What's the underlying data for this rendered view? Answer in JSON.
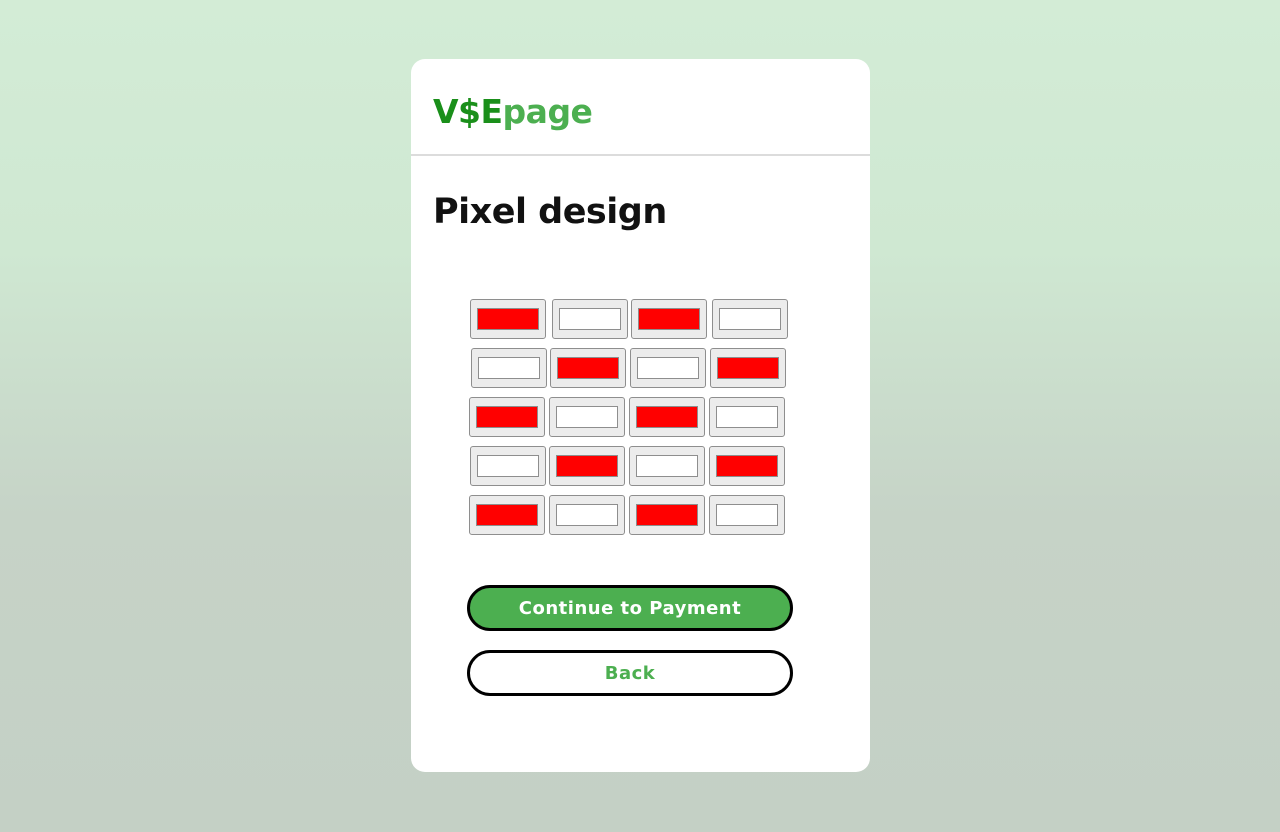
{
  "brand": {
    "part1": "V$E",
    "part2": "page"
  },
  "page_title": "Pixel design",
  "pixel_grid": {
    "on_color": "#ff0000",
    "off_color": "#ffffff",
    "rows": [
      [
        true,
        false,
        true,
        false
      ],
      [
        false,
        true,
        false,
        true
      ],
      [
        true,
        false,
        true,
        false
      ],
      [
        false,
        true,
        false,
        true
      ],
      [
        true,
        false,
        true,
        false
      ]
    ]
  },
  "actions": {
    "continue_label": "Continue to Payment",
    "back_label": "Back"
  },
  "colors": {
    "accent": "#4caf50",
    "brand_dark": "#1a8f1a"
  }
}
